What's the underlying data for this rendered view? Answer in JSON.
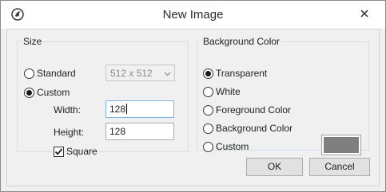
{
  "window": {
    "title": "New Image",
    "icon": "app-logo-icon",
    "close_icon": "close-icon"
  },
  "size_group": {
    "legend": "Size",
    "standard_label": "Standard",
    "standard_selected": false,
    "standard_dropdown_value": "512 x 512",
    "custom_label": "Custom",
    "custom_selected": true,
    "width_label": "Width:",
    "width_value": "128",
    "height_label": "Height:",
    "height_value": "128",
    "square_label": "Square",
    "square_checked": true
  },
  "background_group": {
    "legend": "Background Color",
    "options": [
      {
        "label": "Transparent",
        "selected": true
      },
      {
        "label": "White",
        "selected": false
      },
      {
        "label": "Foreground Color",
        "selected": false
      },
      {
        "label": "Background Color",
        "selected": false
      },
      {
        "label": "Custom",
        "selected": false
      }
    ],
    "custom_color": "#7f7f7f"
  },
  "buttons": {
    "ok_label": "OK",
    "cancel_label": "Cancel"
  }
}
